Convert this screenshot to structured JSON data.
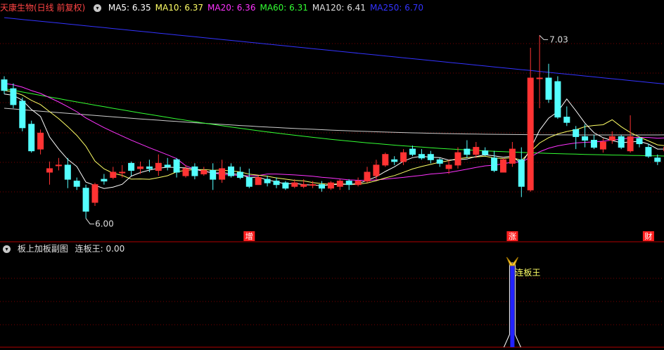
{
  "header": {
    "stock_label": "天康生物(日线 前复权)",
    "ma_items": [
      {
        "label": "MA5: 6.35",
        "color": "#ffffff"
      },
      {
        "label": "MA10: 6.37",
        "color": "#ffff66"
      },
      {
        "label": "MA20: 6.36",
        "color": "#ff33ff"
      },
      {
        "label": "MA60: 6.31",
        "color": "#33ff33"
      },
      {
        "label": "MA120: 6.41",
        "color": "#e0e0e0"
      },
      {
        "label": "MA250: 6.70",
        "color": "#3333ff"
      }
    ]
  },
  "sub_header": {
    "indicator_label": "板上加板副图",
    "value_label": "连板王: 0.00"
  },
  "chart_data": [
    {
      "type": "candlestick",
      "title": "天康生物(日线 前复权)",
      "ylim": [
        5.9,
        7.15
      ],
      "annotations": {
        "high_label": "7.03",
        "low_label": "6.00"
      },
      "event_markers": [
        {
          "label": "增",
          "index": 27
        },
        {
          "label": "涨",
          "index": 56
        },
        {
          "label": "财",
          "index": 71
        }
      ],
      "colors": {
        "up": "#ff3333",
        "down": "#54ffff"
      },
      "candles": [
        {
          "o": 6.78,
          "c": 6.72,
          "h": 6.8,
          "l": 6.7
        },
        {
          "o": 6.73,
          "c": 6.64,
          "h": 6.76,
          "l": 6.62
        },
        {
          "o": 6.66,
          "c": 6.51,
          "h": 6.68,
          "l": 6.49
        },
        {
          "o": 6.53,
          "c": 6.38,
          "h": 6.55,
          "l": 6.37
        },
        {
          "o": 6.39,
          "c": 6.48,
          "h": 6.5,
          "l": 6.36
        },
        {
          "o": 6.26,
          "c": 6.28,
          "h": 6.32,
          "l": 6.19
        },
        {
          "o": 6.3,
          "c": 6.3,
          "h": 6.34,
          "l": 6.27
        },
        {
          "o": 6.3,
          "c": 6.22,
          "h": 6.34,
          "l": 6.17
        },
        {
          "o": 6.21,
          "c": 6.18,
          "h": 6.23,
          "l": 6.16
        },
        {
          "o": 6.17,
          "c": 6.04,
          "h": 6.19,
          "l": 6.0
        },
        {
          "o": 6.09,
          "c": 6.19,
          "h": 6.2,
          "l": 6.07
        },
        {
          "o": 6.22,
          "c": 6.21,
          "h": 6.25,
          "l": 6.19
        },
        {
          "o": 6.23,
          "c": 6.26,
          "h": 6.29,
          "l": 6.22
        },
        {
          "o": 6.26,
          "c": 6.26,
          "h": 6.3,
          "l": 6.23
        },
        {
          "o": 6.31,
          "c": 6.27,
          "h": 6.32,
          "l": 6.24
        },
        {
          "o": 6.28,
          "c": 6.29,
          "h": 6.32,
          "l": 6.25
        },
        {
          "o": 6.29,
          "c": 6.28,
          "h": 6.33,
          "l": 6.26
        },
        {
          "o": 6.27,
          "c": 6.31,
          "h": 6.36,
          "l": 6.24
        },
        {
          "o": 6.3,
          "c": 6.29,
          "h": 6.34,
          "l": 6.27
        },
        {
          "o": 6.33,
          "c": 6.26,
          "h": 6.34,
          "l": 6.23
        },
        {
          "o": 6.24,
          "c": 6.28,
          "h": 6.3,
          "l": 6.23
        },
        {
          "o": 6.29,
          "c": 6.24,
          "h": 6.31,
          "l": 6.22
        },
        {
          "o": 6.25,
          "c": 6.27,
          "h": 6.29,
          "l": 6.24
        },
        {
          "o": 6.27,
          "c": 6.22,
          "h": 6.31,
          "l": 6.16
        },
        {
          "o": 6.22,
          "c": 6.28,
          "h": 6.33,
          "l": 6.2
        },
        {
          "o": 6.29,
          "c": 6.24,
          "h": 6.31,
          "l": 6.23
        },
        {
          "o": 6.26,
          "c": 6.23,
          "h": 6.29,
          "l": 6.22
        },
        {
          "o": 6.23,
          "c": 6.18,
          "h": 6.28,
          "l": 6.17
        },
        {
          "o": 6.19,
          "c": 6.23,
          "h": 6.24,
          "l": 6.19
        },
        {
          "o": 6.22,
          "c": 6.2,
          "h": 6.24,
          "l": 6.18
        },
        {
          "o": 6.21,
          "c": 6.19,
          "h": 6.23,
          "l": 6.17
        },
        {
          "o": 6.2,
          "c": 6.17,
          "h": 6.21,
          "l": 6.16
        },
        {
          "o": 6.18,
          "c": 6.2,
          "h": 6.22,
          "l": 6.17
        },
        {
          "o": 6.18,
          "c": 6.19,
          "h": 6.22,
          "l": 6.17
        },
        {
          "o": 6.19,
          "c": 6.19,
          "h": 6.21,
          "l": 6.17
        },
        {
          "o": 6.19,
          "c": 6.17,
          "h": 6.21,
          "l": 6.15
        },
        {
          "o": 6.17,
          "c": 6.2,
          "h": 6.21,
          "l": 6.16
        },
        {
          "o": 6.18,
          "c": 6.21,
          "h": 6.22,
          "l": 6.16
        },
        {
          "o": 6.21,
          "c": 6.19,
          "h": 6.22,
          "l": 6.16
        },
        {
          "o": 6.19,
          "c": 6.21,
          "h": 6.23,
          "l": 6.18
        },
        {
          "o": 6.21,
          "c": 6.26,
          "h": 6.29,
          "l": 6.2
        },
        {
          "o": 6.24,
          "c": 6.3,
          "h": 6.33,
          "l": 6.22
        },
        {
          "o": 6.3,
          "c": 6.36,
          "h": 6.37,
          "l": 6.29
        },
        {
          "o": 6.33,
          "c": 6.32,
          "h": 6.35,
          "l": 6.3
        },
        {
          "o": 6.32,
          "c": 6.37,
          "h": 6.39,
          "l": 6.3
        },
        {
          "o": 6.39,
          "c": 6.36,
          "h": 6.41,
          "l": 6.35
        },
        {
          "o": 6.36,
          "c": 6.34,
          "h": 6.39,
          "l": 6.33
        },
        {
          "o": 6.36,
          "c": 6.33,
          "h": 6.38,
          "l": 6.31
        },
        {
          "o": 6.33,
          "c": 6.31,
          "h": 6.34,
          "l": 6.29
        },
        {
          "o": 6.28,
          "c": 6.3,
          "h": 6.33,
          "l": 6.25
        },
        {
          "o": 6.3,
          "c": 6.37,
          "h": 6.4,
          "l": 6.28
        },
        {
          "o": 6.39,
          "c": 6.36,
          "h": 6.44,
          "l": 6.34
        },
        {
          "o": 6.36,
          "c": 6.4,
          "h": 6.43,
          "l": 6.34
        },
        {
          "o": 6.38,
          "c": 6.36,
          "h": 6.4,
          "l": 6.35
        },
        {
          "o": 6.34,
          "c": 6.27,
          "h": 6.38,
          "l": 6.26
        },
        {
          "o": 6.26,
          "c": 6.33,
          "h": 6.34,
          "l": 6.27
        },
        {
          "o": 6.31,
          "c": 6.39,
          "h": 6.43,
          "l": 6.29
        },
        {
          "o": 6.33,
          "c": 6.18,
          "h": 6.4,
          "l": 6.12
        },
        {
          "o": 6.16,
          "c": 6.79,
          "h": 6.96,
          "l": 6.15
        },
        {
          "o": 6.79,
          "c": 6.79,
          "h": 7.03,
          "l": 6.62
        },
        {
          "o": 6.79,
          "c": 6.67,
          "h": 6.87,
          "l": 6.65
        },
        {
          "o": 6.77,
          "c": 6.57,
          "h": 6.8,
          "l": 6.56
        },
        {
          "o": 6.57,
          "c": 6.54,
          "h": 6.63,
          "l": 6.52
        },
        {
          "o": 6.5,
          "c": 6.46,
          "h": 6.52,
          "l": 6.39
        },
        {
          "o": 6.46,
          "c": 6.44,
          "h": 6.53,
          "l": 6.4
        },
        {
          "o": 6.44,
          "c": 6.4,
          "h": 6.47,
          "l": 6.39
        },
        {
          "o": 6.39,
          "c": 6.43,
          "h": 6.45,
          "l": 6.37
        },
        {
          "o": 6.44,
          "c": 6.46,
          "h": 6.49,
          "l": 6.42
        },
        {
          "o": 6.46,
          "c": 6.4,
          "h": 6.47,
          "l": 6.39
        },
        {
          "o": 6.38,
          "c": 6.46,
          "h": 6.58,
          "l": 6.37
        },
        {
          "o": 6.45,
          "c": 6.42,
          "h": 6.46,
          "l": 6.4
        },
        {
          "o": 6.4,
          "c": 6.35,
          "h": 6.42,
          "l": 6.34
        },
        {
          "o": 6.34,
          "c": 6.32,
          "h": 6.36,
          "l": 6.3
        },
        {
          "o": 6.38,
          "c": 6.4,
          "h": 6.41,
          "l": 6.37
        },
        {
          "o": 6.43,
          "c": 6.46,
          "h": 6.54,
          "l": 6.39
        }
      ],
      "ma_lines": [
        {
          "name": "MA250",
          "color": "#3333ff",
          "start": [
            0,
            7.13
          ],
          "end": [
            74,
            6.75
          ]
        },
        {
          "name": "MA120",
          "color": "#cccccc",
          "start": [
            0,
            6.62
          ],
          "end": [
            74,
            6.47
          ]
        },
        {
          "name": "MA60",
          "color": "#33ff33",
          "start": [
            0,
            6.73
          ],
          "end": [
            74,
            6.35
          ]
        },
        {
          "name": "MA20",
          "color": "#ff33ff",
          "start": [
            0,
            6.76
          ],
          "end": [
            74,
            6.44
          ]
        },
        {
          "name": "MA10",
          "color": "#ffff66",
          "start": [
            0,
            6.72
          ],
          "end": [
            74,
            6.42
          ]
        },
        {
          "name": "MA5",
          "color": "#ffffff",
          "start": [
            0,
            6.7
          ],
          "end": [
            74,
            6.4
          ]
        }
      ]
    },
    {
      "type": "bar",
      "title": "板上加板副图",
      "series": [
        {
          "name": "连板王",
          "values": [
            {
              "index": 56,
              "value": 1
            }
          ]
        }
      ],
      "annotations": {
        "signal_label": "连板王"
      },
      "colors": {
        "bar": "#2222ff",
        "outline": "#ffffff"
      }
    }
  ]
}
